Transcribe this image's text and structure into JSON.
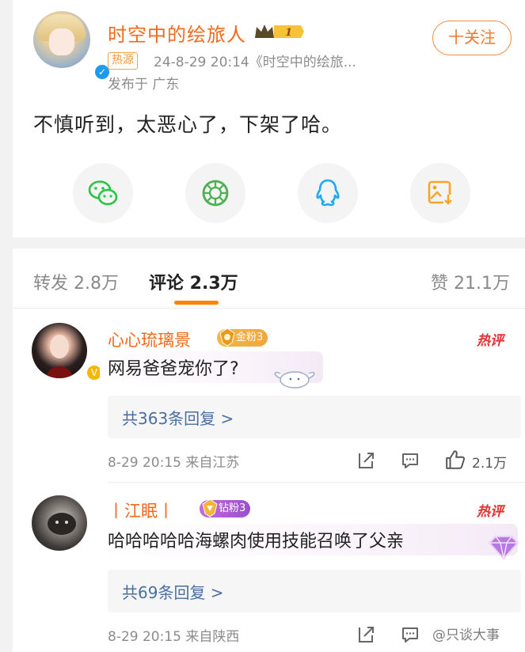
{
  "post": {
    "username": "时空中的绘旅人",
    "badge_level": "1",
    "hot_tag": "热源",
    "meta": "24-8-29 20:14《时空中的绘旅...",
    "location": "发布于 广东",
    "follow_label": "十关注",
    "text": "不慎听到，太恶心了，下架了哈。"
  },
  "share": {
    "icons": [
      "wechat-icon",
      "moments-icon",
      "qq-icon",
      "save-image-icon"
    ]
  },
  "tabs": {
    "repost": "转发 2.8万",
    "comments": "评论 2.3万",
    "likes": "赞 21.1万"
  },
  "comments": [
    {
      "name": "心心琉璃景",
      "fan_badge": "金粉3",
      "hot": "热评",
      "text": "网易爸爸宠你了?",
      "replies": "共363条回复 >",
      "meta": "8-29 20:15 来自江苏",
      "likes": "2.1万"
    },
    {
      "name": "丨江眠丨",
      "fan_badge": "钻粉3",
      "hot": "热评",
      "text": "哈哈哈哈哈海螺肉使用技能召唤了父亲",
      "replies": "共69条回复 >",
      "meta": "8-29 20:15 来自陕西"
    }
  ],
  "watermark": "@只谈大事",
  "colors": {
    "accent": "#ff8200",
    "username": "#f26a1b",
    "hot": "#e53030",
    "link": "#4a6ea0",
    "wechat": "#28c445",
    "moments": "#4caf50",
    "qq": "#1eaaf1",
    "save": "#f5a623"
  }
}
